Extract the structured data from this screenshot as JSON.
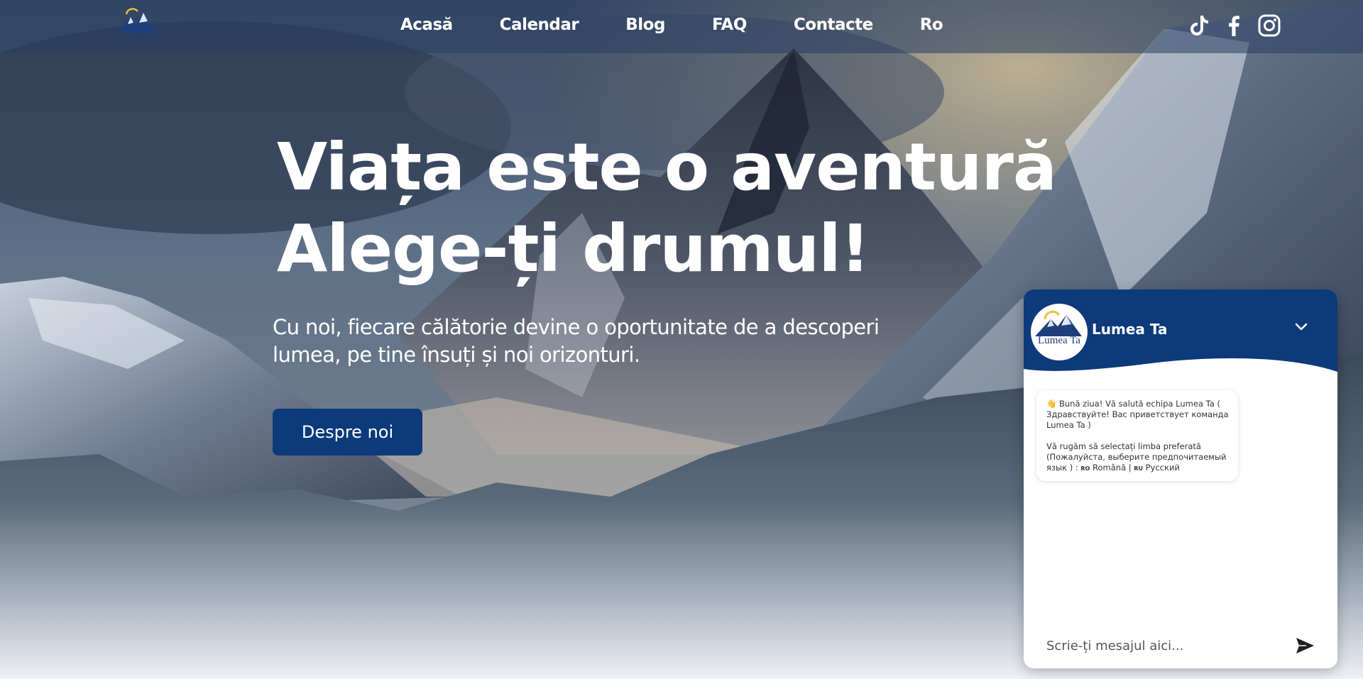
{
  "brand": {
    "logo_text": "Lumea Ta",
    "primary_color": "#0c3a7a"
  },
  "nav": {
    "items": [
      {
        "label": "Acasă"
      },
      {
        "label": "Calendar"
      },
      {
        "label": "Blog"
      },
      {
        "label": "FAQ"
      },
      {
        "label": "Contacte"
      },
      {
        "label": "Ro"
      }
    ]
  },
  "social": {
    "icons": [
      "tiktok-icon",
      "facebook-icon",
      "instagram-icon"
    ]
  },
  "hero": {
    "title_line1": "Viața este o aventură",
    "title_line2": "Alege-ți drumul!",
    "subtitle_line1": "Cu noi, fiecare călătorie devine o oportunitate de a descoperi",
    "subtitle_line2": "lumea, pe tine însuți și noi orizonturi.",
    "button_label": "Despre noi"
  },
  "chat": {
    "title": "Lumea Ta",
    "avatar_text": "Lumea Ta",
    "header_color": "#0c3a7a",
    "message": {
      "emoji": "👋",
      "greeting": "Bună ziua! Vă salută echipa Lumea Ta ( Здравствуйте! Вас приветствует команда Lumea Ta )",
      "prompt": "Vă rugăm să selectați limba preferată (Пожалуйста, выберите предпочитаемый язык ) :",
      "flag_ro": "RO",
      "lang_ro": "Română |",
      "flag_ru": "RU",
      "lang_ru": "Русский"
    },
    "input_placeholder": "Scrie-ți mesajul aici..."
  }
}
